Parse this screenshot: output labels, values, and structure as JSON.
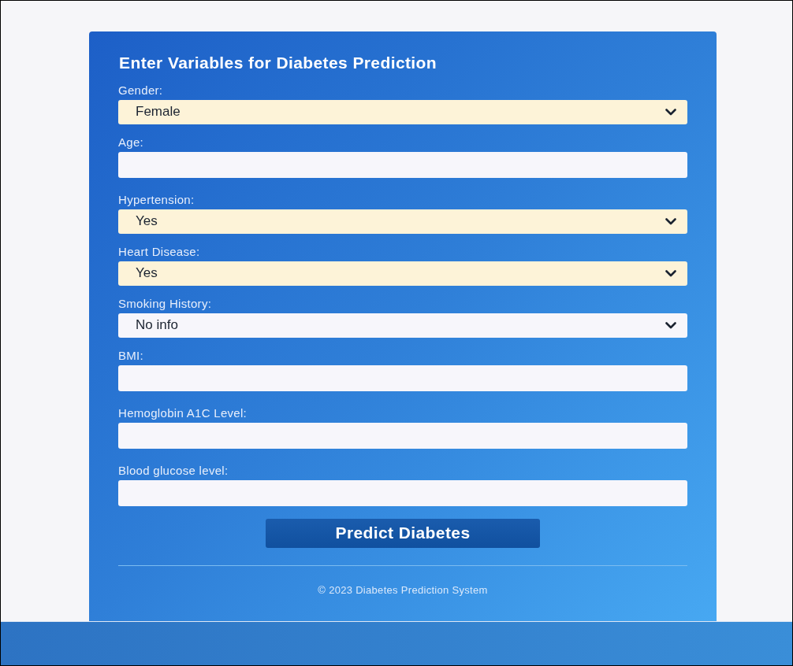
{
  "form": {
    "title": "Enter Variables for Diabetes Prediction",
    "fields": [
      {
        "kind": "select",
        "label": "Gender:",
        "value": "Female",
        "autofilled": true
      },
      {
        "kind": "input",
        "label": "Age:",
        "autofilled": false
      },
      {
        "kind": "select",
        "label": "Hypertension:",
        "value": "Yes",
        "autofilled": true
      },
      {
        "kind": "select",
        "label": "Heart Disease:",
        "value": "Yes",
        "autofilled": true
      },
      {
        "kind": "select",
        "label": "Smoking History:",
        "value": "No info",
        "autofilled": false
      },
      {
        "kind": "input",
        "label": "BMI:",
        "autofilled": false
      },
      {
        "kind": "input",
        "label": "Hemoglobin A1C Level:",
        "autofilled": false
      },
      {
        "kind": "input",
        "label": "Blood glucose level:",
        "autofilled": false
      }
    ],
    "submit": "Predict Diabetes"
  },
  "footer": "© 2023 Diabetes Prediction System"
}
